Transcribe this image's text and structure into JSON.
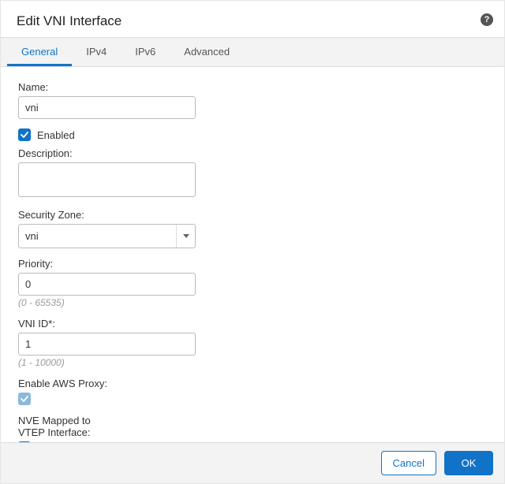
{
  "dialog": {
    "title": "Edit VNI Interface"
  },
  "tabs": {
    "general": "General",
    "ipv4": "IPv4",
    "ipv6": "IPv6",
    "advanced": "Advanced",
    "active": "general"
  },
  "form": {
    "name": {
      "label": "Name:",
      "value": "vni"
    },
    "enabled": {
      "label": "Enabled",
      "checked": true
    },
    "description": {
      "label": "Description:",
      "value": ""
    },
    "securityZone": {
      "label": "Security Zone:",
      "selected": "vni"
    },
    "priority": {
      "label": "Priority:",
      "value": "0",
      "hint": "(0 - 65535)"
    },
    "vniId": {
      "label": "VNI ID*:",
      "value": "1",
      "hint": "(1 - 10000)"
    },
    "awsProxy": {
      "label": "Enable AWS Proxy:",
      "checked": true
    },
    "nveMapped": {
      "label": "NVE Mapped to\nVTEP Interface:",
      "checked": true
    }
  },
  "footer": {
    "cancel": "Cancel",
    "ok": "OK"
  }
}
